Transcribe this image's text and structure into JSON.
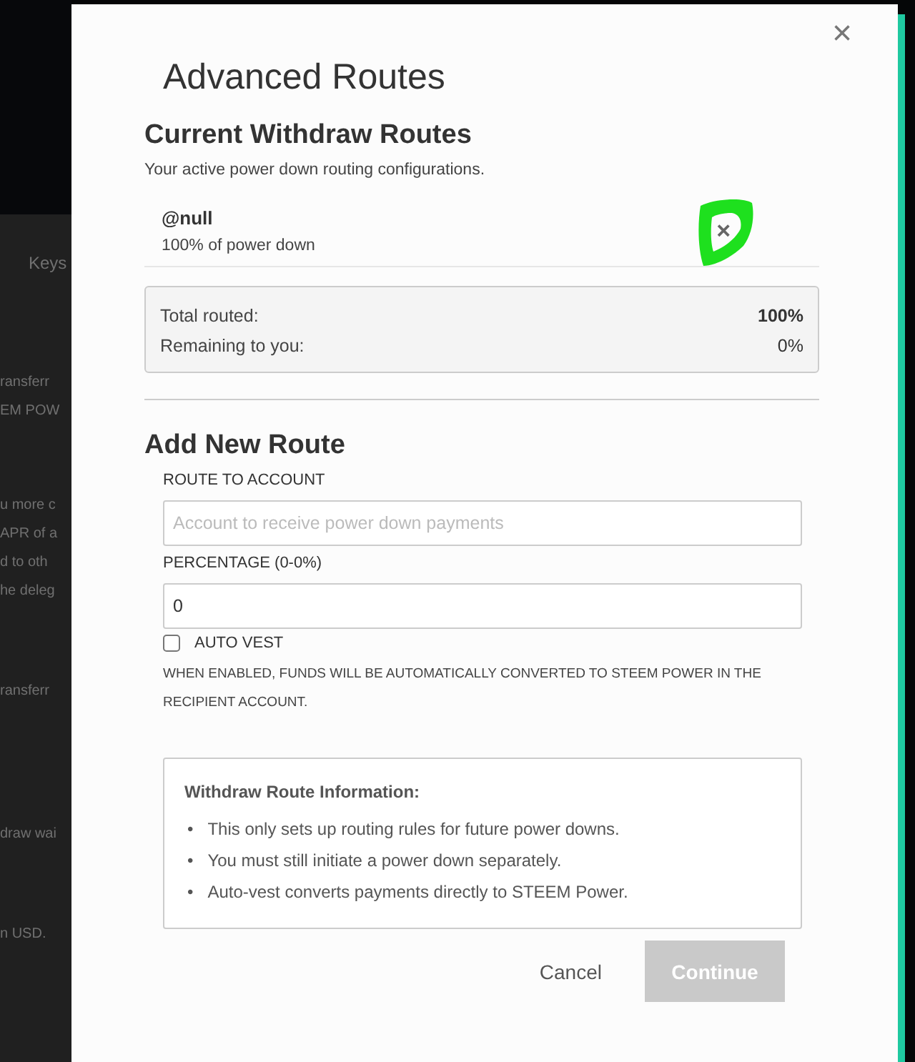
{
  "background": {
    "tab": "Keys",
    "blocks": [
      [
        "ransferr",
        "EM POW"
      ],
      [
        "u more c",
        "APR of a",
        "d to oth",
        "he deleg"
      ],
      [
        "ransferr"
      ],
      [
        "draw wai"
      ],
      [
        "n USD."
      ]
    ]
  },
  "dialog": {
    "close": "×",
    "title": "Advanced Routes",
    "current": {
      "heading": "Current Withdraw Routes",
      "subtitle": "Your active power down routing configurations.",
      "routes": [
        {
          "account": "@null",
          "share": "100% of power down",
          "remove": "×",
          "highlighted": true
        }
      ],
      "summary": [
        {
          "label": "Total routed:",
          "value": "100%"
        },
        {
          "label": "Remaining to you:",
          "value": "0%"
        }
      ]
    },
    "add": {
      "heading": "Add New Route",
      "account_label": "ROUTE TO ACCOUNT",
      "account_placeholder": "Account to receive power down payments",
      "percent_label": "PERCENTAGE (0-0%)",
      "percent_value": "0",
      "auto_vest": {
        "label": "AUTO VEST",
        "checked": false
      },
      "note": "WHEN ENABLED, FUNDS WILL BE AUTOMATICALLY CONVERTED TO STEEM POWER IN THE RECIPIENT ACCOUNT."
    },
    "info": {
      "title": "Withdraw Route Information:",
      "bullet": "•",
      "items": [
        "This only sets up routing rules for future power downs.",
        "You must still initiate a power down separately.",
        "Auto-vest converts payments directly to STEEM Power."
      ]
    },
    "buttons": [
      {
        "label": "Cancel",
        "kind": "link",
        "disabled": false
      },
      {
        "label": "Continue",
        "kind": "primary",
        "disabled": true
      }
    ]
  }
}
